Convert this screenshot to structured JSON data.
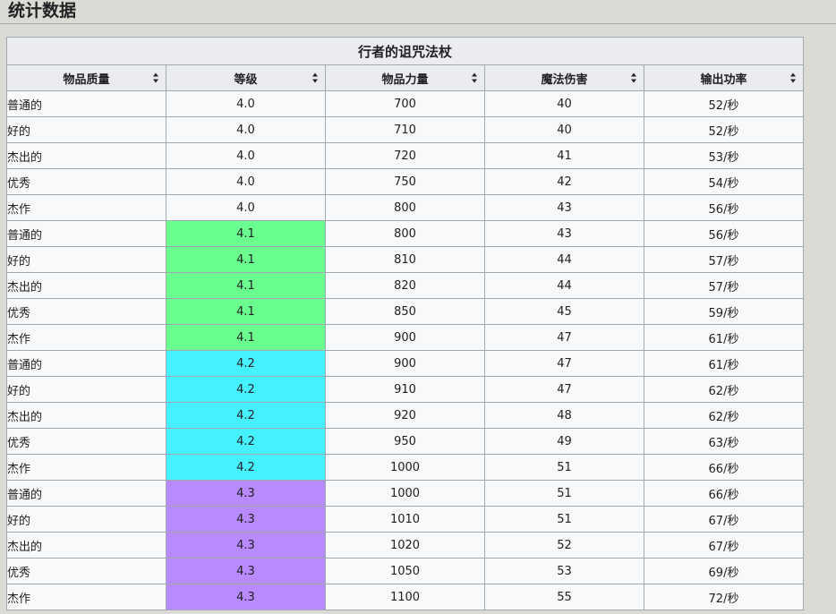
{
  "section": {
    "title": "统计数据"
  },
  "table": {
    "caption": "行者的诅咒法杖",
    "columns": [
      "物品质量",
      "等级",
      "物品力量",
      "魔法伤害",
      "输出功率"
    ],
    "tier_colors": {
      "4.0": "",
      "4.1": "#6bff8f",
      "4.2": "#45f0ff",
      "4.3": "#b78aff"
    },
    "rows": [
      [
        "普通的",
        "4.0",
        "700",
        "40",
        "52/秒"
      ],
      [
        "好的",
        "4.0",
        "710",
        "40",
        "52/秒"
      ],
      [
        "杰出的",
        "4.0",
        "720",
        "41",
        "53/秒"
      ],
      [
        "优秀",
        "4.0",
        "750",
        "42",
        "54/秒"
      ],
      [
        "杰作",
        "4.0",
        "800",
        "43",
        "56/秒"
      ],
      [
        "普通的",
        "4.1",
        "800",
        "43",
        "56/秒"
      ],
      [
        "好的",
        "4.1",
        "810",
        "44",
        "57/秒"
      ],
      [
        "杰出的",
        "4.1",
        "820",
        "44",
        "57/秒"
      ],
      [
        "优秀",
        "4.1",
        "850",
        "45",
        "59/秒"
      ],
      [
        "杰作",
        "4.1",
        "900",
        "47",
        "61/秒"
      ],
      [
        "普通的",
        "4.2",
        "900",
        "47",
        "61/秒"
      ],
      [
        "好的",
        "4.2",
        "910",
        "47",
        "62/秒"
      ],
      [
        "杰出的",
        "4.2",
        "920",
        "48",
        "62/秒"
      ],
      [
        "优秀",
        "4.2",
        "950",
        "49",
        "63/秒"
      ],
      [
        "杰作",
        "4.2",
        "1000",
        "51",
        "66/秒"
      ],
      [
        "普通的",
        "4.3",
        "1000",
        "51",
        "66/秒"
      ],
      [
        "好的",
        "4.3",
        "1010",
        "51",
        "67/秒"
      ],
      [
        "杰出的",
        "4.3",
        "1020",
        "52",
        "67/秒"
      ],
      [
        "优秀",
        "4.3",
        "1050",
        "53",
        "69/秒"
      ],
      [
        "杰作",
        "4.3",
        "1100",
        "55",
        "72/秒"
      ]
    ]
  }
}
